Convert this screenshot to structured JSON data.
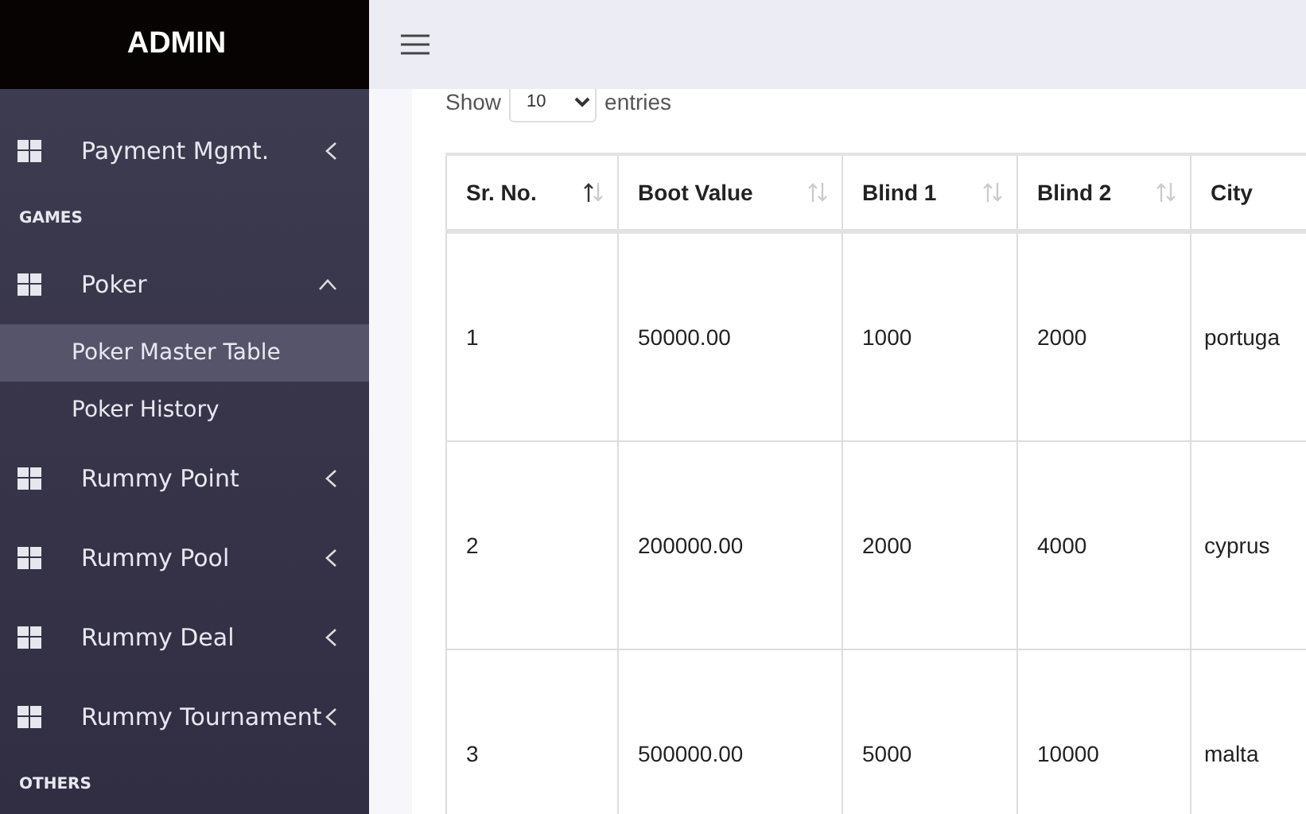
{
  "sidebar": {
    "brand": "ADMIN",
    "items": [
      {
        "kind": "menu",
        "label": "Payment Mgmt.",
        "expanded": false
      },
      {
        "kind": "section",
        "label": "GAMES"
      },
      {
        "kind": "menu",
        "label": "Poker",
        "expanded": true,
        "children": [
          {
            "label": "Poker Master Table",
            "selected": true
          },
          {
            "label": "Poker History",
            "selected": false
          }
        ]
      },
      {
        "kind": "menu",
        "label": "Rummy Point",
        "expanded": false
      },
      {
        "kind": "menu",
        "label": "Rummy Pool",
        "expanded": false
      },
      {
        "kind": "menu",
        "label": "Rummy Deal",
        "expanded": false
      },
      {
        "kind": "menu",
        "label": "Rummy Tournament",
        "expanded": false
      },
      {
        "kind": "section",
        "label": "OTHERS"
      }
    ]
  },
  "length": {
    "before": "Show",
    "value": "10",
    "after": "entries"
  },
  "table": {
    "columns": [
      {
        "label": "Sr. No.",
        "sorted": true
      },
      {
        "label": "Boot Value",
        "sorted": false
      },
      {
        "label": "Blind 1",
        "sorted": false
      },
      {
        "label": "Blind 2",
        "sorted": false
      },
      {
        "label": "City"
      }
    ],
    "rows": [
      [
        "1",
        "50000.00",
        "1000",
        "2000",
        "portuga"
      ],
      [
        "2",
        "200000.00",
        "2000",
        "4000",
        "cyprus"
      ],
      [
        "3",
        "500000.00",
        "5000",
        "10000",
        "malta"
      ]
    ]
  }
}
